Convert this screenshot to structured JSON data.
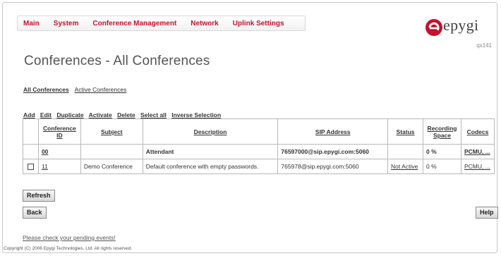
{
  "topmenu": [
    "Main",
    "System",
    "Conference Management",
    "Network",
    "Uplink Settings"
  ],
  "logo": {
    "text": "epygi",
    "color": "#c8102e"
  },
  "device_name": "qx141",
  "page_title": "Conferences - All Conferences",
  "subtabs": [
    {
      "label": "All Conferences",
      "active": true
    },
    {
      "label": "Active Conferences",
      "active": false
    }
  ],
  "actions": [
    "Add",
    "Edit",
    "Duplicate",
    "Activate",
    "Delete",
    "Select all",
    "Inverse Selection"
  ],
  "table": {
    "headers": {
      "checkbox": "",
      "conference_id": "Conference ID",
      "subject": "Subject",
      "description": "Description",
      "sip_address": "SIP Address",
      "status": "Status",
      "recording_space": "Recording Space",
      "codecs": "Codecs"
    },
    "rows": [
      {
        "conference_id": "00",
        "subject": "",
        "description": "Attendant",
        "sip_address": "76597000@sip.epygi.com:5060",
        "status": "",
        "recording_space": "0 %",
        "codecs": "PCMU, ..."
      },
      {
        "conference_id": "11",
        "subject": "Demo Conference",
        "description": "Default conference with empty passwords.",
        "sip_address": "765978@sip.epygi.com:5060",
        "status": "Not Active",
        "recording_space": "0 %",
        "codecs": "PCMU, ..."
      }
    ]
  },
  "buttons": {
    "refresh": "Refresh",
    "back": "Back",
    "help": "Help"
  },
  "pending_events_link": "Please check your pending events!",
  "copyright": "Copyright (C) 2006 Epygi Technologies, Ltd. All rights reserved."
}
